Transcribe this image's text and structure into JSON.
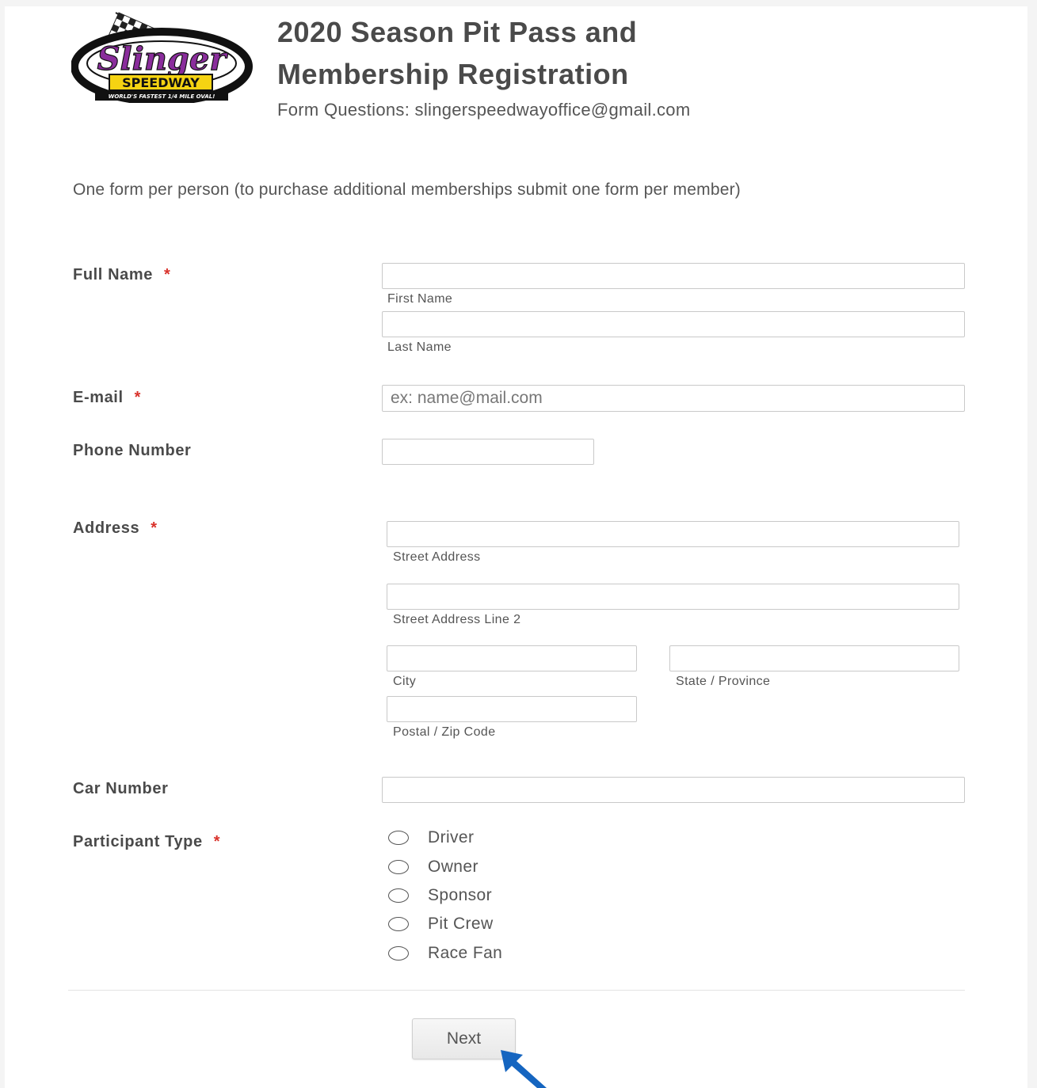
{
  "header": {
    "title_line1": "2020 Season Pit Pass and",
    "title_line2": "Membership Registration",
    "subheader": "Form Questions: slingerspeedwayoffice@gmail.com"
  },
  "logo": {
    "wordmark": "Slinger",
    "badge": "SPEEDWAY",
    "tagline": "WORLD'S FASTEST 1/4 MILE OVAL!",
    "colors": {
      "purple": "#8a2d9c",
      "yellow": "#f5d312",
      "black": "#111111"
    }
  },
  "intro": "One form per person (to purchase additional memberships submit one form per member)",
  "fields": {
    "full_name": {
      "label": "Full Name",
      "required": "*",
      "first_sublabel": "First Name",
      "last_sublabel": "Last Name",
      "first_value": "",
      "last_value": ""
    },
    "email": {
      "label": "E-mail",
      "required": "*",
      "placeholder": "ex: name@mail.com",
      "value": ""
    },
    "phone": {
      "label": "Phone Number",
      "value": ""
    },
    "address": {
      "label": "Address",
      "required": "*",
      "street_sublabel": "Street Address",
      "street2_sublabel": "Street Address Line 2",
      "city_sublabel": "City",
      "state_sublabel": "State / Province",
      "zip_sublabel": "Postal / Zip Code"
    },
    "car_number": {
      "label": "Car Number",
      "value": ""
    },
    "participant_type": {
      "label": "Participant Type",
      "required": "*",
      "options": [
        "Driver",
        "Owner",
        "Sponsor",
        "Pit Crew",
        "Race Fan"
      ]
    }
  },
  "next_button": "Next",
  "colors": {
    "required": "#d9322b",
    "cursor": "#1565c0"
  }
}
